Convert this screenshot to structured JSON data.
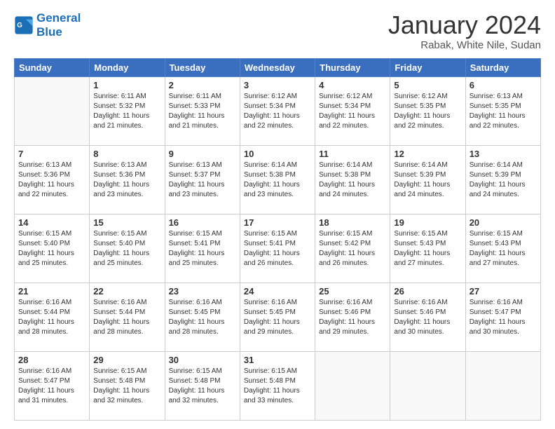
{
  "logo": {
    "line1": "General",
    "line2": "Blue"
  },
  "title": "January 2024",
  "subtitle": "Rabak, White Nile, Sudan",
  "days_header": [
    "Sunday",
    "Monday",
    "Tuesday",
    "Wednesday",
    "Thursday",
    "Friday",
    "Saturday"
  ],
  "weeks": [
    [
      {
        "day": "",
        "info": ""
      },
      {
        "day": "1",
        "info": "Sunrise: 6:11 AM\nSunset: 5:32 PM\nDaylight: 11 hours\nand 21 minutes."
      },
      {
        "day": "2",
        "info": "Sunrise: 6:11 AM\nSunset: 5:33 PM\nDaylight: 11 hours\nand 21 minutes."
      },
      {
        "day": "3",
        "info": "Sunrise: 6:12 AM\nSunset: 5:34 PM\nDaylight: 11 hours\nand 22 minutes."
      },
      {
        "day": "4",
        "info": "Sunrise: 6:12 AM\nSunset: 5:34 PM\nDaylight: 11 hours\nand 22 minutes."
      },
      {
        "day": "5",
        "info": "Sunrise: 6:12 AM\nSunset: 5:35 PM\nDaylight: 11 hours\nand 22 minutes."
      },
      {
        "day": "6",
        "info": "Sunrise: 6:13 AM\nSunset: 5:35 PM\nDaylight: 11 hours\nand 22 minutes."
      }
    ],
    [
      {
        "day": "7",
        "info": "Sunrise: 6:13 AM\nSunset: 5:36 PM\nDaylight: 11 hours\nand 22 minutes."
      },
      {
        "day": "8",
        "info": "Sunrise: 6:13 AM\nSunset: 5:36 PM\nDaylight: 11 hours\nand 23 minutes."
      },
      {
        "day": "9",
        "info": "Sunrise: 6:13 AM\nSunset: 5:37 PM\nDaylight: 11 hours\nand 23 minutes."
      },
      {
        "day": "10",
        "info": "Sunrise: 6:14 AM\nSunset: 5:38 PM\nDaylight: 11 hours\nand 23 minutes."
      },
      {
        "day": "11",
        "info": "Sunrise: 6:14 AM\nSunset: 5:38 PM\nDaylight: 11 hours\nand 24 minutes."
      },
      {
        "day": "12",
        "info": "Sunrise: 6:14 AM\nSunset: 5:39 PM\nDaylight: 11 hours\nand 24 minutes."
      },
      {
        "day": "13",
        "info": "Sunrise: 6:14 AM\nSunset: 5:39 PM\nDaylight: 11 hours\nand 24 minutes."
      }
    ],
    [
      {
        "day": "14",
        "info": "Sunrise: 6:15 AM\nSunset: 5:40 PM\nDaylight: 11 hours\nand 25 minutes."
      },
      {
        "day": "15",
        "info": "Sunrise: 6:15 AM\nSunset: 5:40 PM\nDaylight: 11 hours\nand 25 minutes."
      },
      {
        "day": "16",
        "info": "Sunrise: 6:15 AM\nSunset: 5:41 PM\nDaylight: 11 hours\nand 25 minutes."
      },
      {
        "day": "17",
        "info": "Sunrise: 6:15 AM\nSunset: 5:41 PM\nDaylight: 11 hours\nand 26 minutes."
      },
      {
        "day": "18",
        "info": "Sunrise: 6:15 AM\nSunset: 5:42 PM\nDaylight: 11 hours\nand 26 minutes."
      },
      {
        "day": "19",
        "info": "Sunrise: 6:15 AM\nSunset: 5:43 PM\nDaylight: 11 hours\nand 27 minutes."
      },
      {
        "day": "20",
        "info": "Sunrise: 6:15 AM\nSunset: 5:43 PM\nDaylight: 11 hours\nand 27 minutes."
      }
    ],
    [
      {
        "day": "21",
        "info": "Sunrise: 6:16 AM\nSunset: 5:44 PM\nDaylight: 11 hours\nand 28 minutes."
      },
      {
        "day": "22",
        "info": "Sunrise: 6:16 AM\nSunset: 5:44 PM\nDaylight: 11 hours\nand 28 minutes."
      },
      {
        "day": "23",
        "info": "Sunrise: 6:16 AM\nSunset: 5:45 PM\nDaylight: 11 hours\nand 28 minutes."
      },
      {
        "day": "24",
        "info": "Sunrise: 6:16 AM\nSunset: 5:45 PM\nDaylight: 11 hours\nand 29 minutes."
      },
      {
        "day": "25",
        "info": "Sunrise: 6:16 AM\nSunset: 5:46 PM\nDaylight: 11 hours\nand 29 minutes."
      },
      {
        "day": "26",
        "info": "Sunrise: 6:16 AM\nSunset: 5:46 PM\nDaylight: 11 hours\nand 30 minutes."
      },
      {
        "day": "27",
        "info": "Sunrise: 6:16 AM\nSunset: 5:47 PM\nDaylight: 11 hours\nand 30 minutes."
      }
    ],
    [
      {
        "day": "28",
        "info": "Sunrise: 6:16 AM\nSunset: 5:47 PM\nDaylight: 11 hours\nand 31 minutes."
      },
      {
        "day": "29",
        "info": "Sunrise: 6:15 AM\nSunset: 5:48 PM\nDaylight: 11 hours\nand 32 minutes."
      },
      {
        "day": "30",
        "info": "Sunrise: 6:15 AM\nSunset: 5:48 PM\nDaylight: 11 hours\nand 32 minutes."
      },
      {
        "day": "31",
        "info": "Sunrise: 6:15 AM\nSunset: 5:48 PM\nDaylight: 11 hours\nand 33 minutes."
      },
      {
        "day": "",
        "info": ""
      },
      {
        "day": "",
        "info": ""
      },
      {
        "day": "",
        "info": ""
      }
    ]
  ]
}
